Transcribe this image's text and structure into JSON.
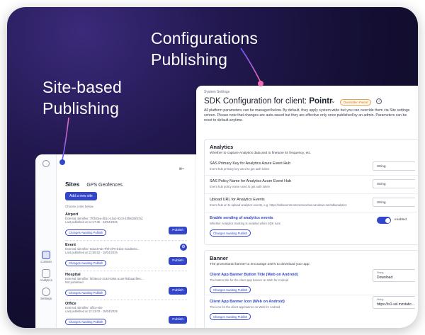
{
  "headlines": {
    "config": [
      "Configurations",
      "Publishing"
    ],
    "site": [
      "Site-based",
      "Publishing"
    ]
  },
  "colors": {
    "accent": "#3346c9",
    "pointer": "#f06ab0",
    "badge": "#d07a16",
    "background": "#140f33"
  },
  "sites_panel": {
    "collapse_icon": "collapse-left-icon",
    "tabs": [
      "Sites",
      "GPS Geofences"
    ],
    "add_button": "Add a new site",
    "hint": "Choose a site below.",
    "rail": [
      "Content",
      "Analytics",
      "Settings"
    ],
    "sites": [
      {
        "name": "Airport",
        "id": "External Identifier: 7f0f40ea-d51c-41a2-92c0-43f6625f57a1",
        "published": "Last published at 14:17:35 - 23/04/2025",
        "chip": "Changes Awaiting Publish",
        "publish": "Publish"
      },
      {
        "name": "Event",
        "id": "External Identifier: 9da447ab-7f9f-4f79-b1b3-41ad6ebc...",
        "published": "Last published at 13:55:52 - 15/04/2025",
        "chip": "Changes Awaiting Publish",
        "publish": "Publish"
      },
      {
        "name": "Hospital",
        "id": "External Identifier: f4f36ec0-313d-4954-a1a0-f93baa2f9ec...",
        "published": "Not published",
        "chip": "Changes Awaiting Publish",
        "publish": "Publish"
      },
      {
        "name": "Office",
        "id": "External Identifier: office-site",
        "published": "Last published at 12:13:03 - 15/04/2025",
        "chip": "Changes Awaiting Publish",
        "publish": "Publish"
      }
    ]
  },
  "config_panel": {
    "breadcrumb": "System Settings",
    "title_prefix": "SDK Configuration for client:",
    "client": "Pointr",
    "badge": "Overridden Parent",
    "description": "All platform parameters can be managed below. By default, they apply system-wide but you can override them via Site settings screen. Please note that changes are auto-saved but they are effective only once published by an admin. Parameters can be reset to default anytime.",
    "analytics": {
      "title": "Analytics",
      "subtitle": "Whether to capture Analytics data and to finetune its frequency, etc.",
      "fields": [
        {
          "label": "SAS Primary Key for Analytics Azure Event Hub",
          "help": "Event hub primary key used to get auth token",
          "value": "String"
        },
        {
          "label": "SAS Policy Name for Analytics Azure Event Hub",
          "help": "Event hub policy name used to get auth token",
          "value": "String"
        },
        {
          "label": "Upload URL for Analytics Events",
          "help": "Event hub url to upload analytics events, e.g. https://sdkevents-test.servicebus.windows.net/sdkanalytics",
          "value": "String"
        }
      ],
      "toggle_field": {
        "label": "Enable sending of analytics events",
        "help": "Whether Analytics tracking is enabled when SDK runs",
        "state": "enabled",
        "chip": "Changes Awaiting Publish"
      }
    },
    "banner": {
      "title": "Banner",
      "subtitle": "The promotional banner to encourage users to download your app.",
      "fields": [
        {
          "label": "Client App Banner Button Title (Web on Android)",
          "help": "The button title for the client app banner on Web for Android",
          "type": "String",
          "value": "Download",
          "chip": "Changes Awaiting Publish"
        },
        {
          "label": "Client App Banner Icon (Web on Android)",
          "help": "The icon for the client app banner on Web for Android",
          "type": "String",
          "value": "https://is1-ssl.mzstatic...",
          "chip": "Changes Awaiting Publish"
        }
      ]
    }
  }
}
